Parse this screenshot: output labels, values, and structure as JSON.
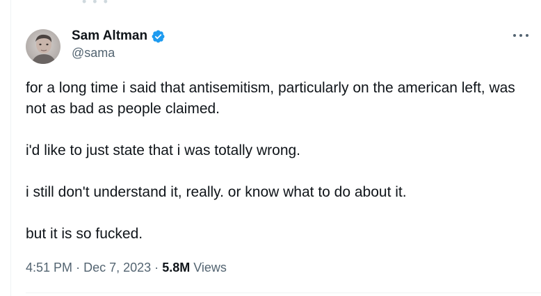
{
  "author": {
    "display_name": "Sam Altman",
    "handle": "@sama",
    "verified": true
  },
  "icons": {
    "avatar": "avatar-photo",
    "verified": "verified-badge-icon",
    "more": "more-options-icon"
  },
  "tweet": {
    "paragraphs": [
      "for a long time i said that antisemitism, particularly on the american left, was not as bad as people claimed.",
      "i'd like to just state that i was totally wrong.",
      "i still don't understand it, really. or know what to do about it.",
      "but it is so fucked."
    ]
  },
  "meta": {
    "time": "4:51 PM",
    "separator": "·",
    "date": "Dec 7, 2023",
    "views_count": "5.8M",
    "views_label": "Views"
  },
  "colors": {
    "text_primary": "#0f1419",
    "text_secondary": "#536471",
    "verified_blue": "#1d9bf0",
    "divider": "#eff3f4"
  }
}
